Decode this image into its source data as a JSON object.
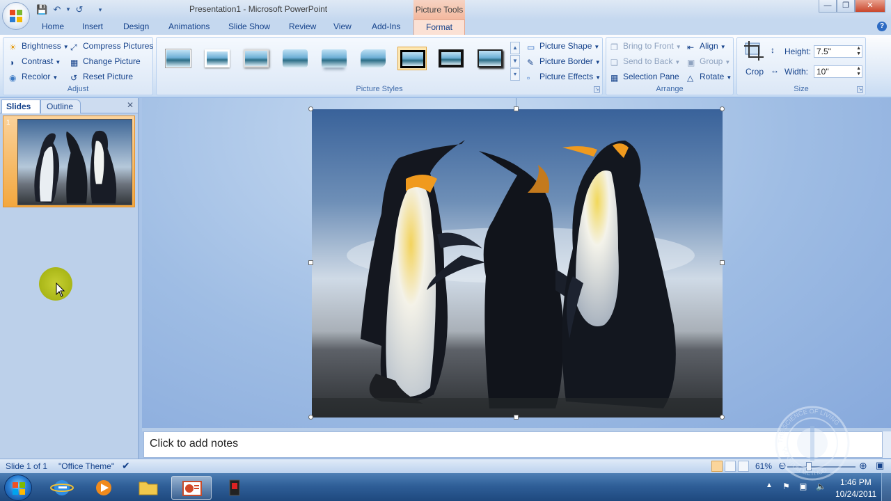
{
  "window": {
    "title": "Presentation1 - Microsoft PowerPoint",
    "contextual_tab_group": "Picture Tools"
  },
  "tabs": [
    {
      "label": "Home"
    },
    {
      "label": "Insert"
    },
    {
      "label": "Design"
    },
    {
      "label": "Animations"
    },
    {
      "label": "Slide Show"
    },
    {
      "label": "Review"
    },
    {
      "label": "View"
    },
    {
      "label": "Add-Ins"
    },
    {
      "label": "Format",
      "active": true
    }
  ],
  "ribbon": {
    "adjust": {
      "label": "Adjust",
      "brightness": "Brightness",
      "contrast": "Contrast",
      "recolor": "Recolor",
      "compress_pictures": "Compress Pictures",
      "change_picture": "Change Picture",
      "reset_picture": "Reset Picture"
    },
    "picture_styles": {
      "label": "Picture Styles",
      "picture_shape": "Picture Shape",
      "picture_border": "Picture Border",
      "picture_effects": "Picture Effects",
      "style_count": 9,
      "selected_style_index": 6
    },
    "arrange": {
      "label": "Arrange",
      "bring_to_front": "Bring to Front",
      "send_to_back": "Send to Back",
      "selection_pane": "Selection Pane",
      "align": "Align",
      "group": "Group",
      "rotate": "Rotate"
    },
    "size": {
      "label": "Size",
      "crop": "Crop",
      "height_label": "Height:",
      "height_value": "7.5\"",
      "width_label": "Width:",
      "width_value": "10\""
    }
  },
  "left_pane": {
    "tab_slides": "Slides",
    "tab_outline": "Outline",
    "slide_number": "1"
  },
  "notes": {
    "placeholder": "Click to add notes"
  },
  "statusbar": {
    "slide_indicator": "Slide 1 of 1",
    "theme": "\"Office Theme\"",
    "zoom": "61%"
  },
  "taskbar": {
    "time": "1:46 PM",
    "date": "10/24/2011"
  },
  "watermark": {
    "text_top": "THE SCIENCE OF LIVING",
    "text_bottom": "QUANTUM METHOD"
  },
  "colors": {
    "ribbon_accent": "#15428b",
    "contextual_tab": "#f3b89e",
    "selected_thumb": "#f3a73e"
  }
}
